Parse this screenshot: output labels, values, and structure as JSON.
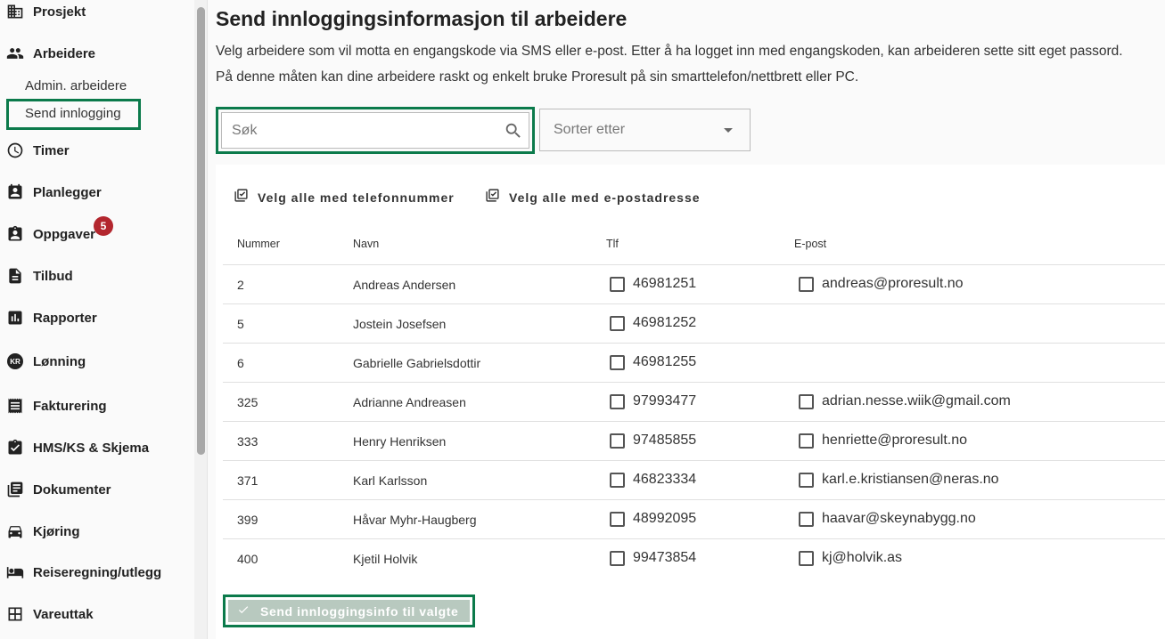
{
  "sidebar": {
    "items": [
      {
        "label": "Prosjekt",
        "icon": "building-icon"
      },
      {
        "label": "Arbeidere",
        "icon": "people-icon"
      },
      {
        "label": "Timer",
        "icon": "clock-icon"
      },
      {
        "label": "Planlegger",
        "icon": "planner-icon"
      },
      {
        "label": "Oppgaver",
        "icon": "tasks-icon",
        "badge": "5"
      },
      {
        "label": "Tilbud",
        "icon": "document-icon"
      },
      {
        "label": "Rapporter",
        "icon": "bar-chart-icon"
      },
      {
        "label": "Lønning",
        "icon": "kr-icon",
        "icon_text": "KR"
      },
      {
        "label": "Fakturering",
        "icon": "receipt-icon"
      },
      {
        "label": "HMS/KS & Skjema",
        "icon": "clipboard-check-icon"
      },
      {
        "label": "Dokumenter",
        "icon": "library-icon"
      },
      {
        "label": "Kjøring",
        "icon": "car-icon"
      },
      {
        "label": "Reiseregning/utlegg",
        "icon": "bed-icon"
      },
      {
        "label": "Vareuttak",
        "icon": "dashboard-icon"
      }
    ],
    "subitems": [
      {
        "label": "Admin. arbeidere"
      },
      {
        "label": "Send innlogging",
        "active": true
      }
    ]
  },
  "page": {
    "title": "Send innloggingsinformasjon til arbeidere",
    "desc_line1": "Velg arbeidere som vil motta en engangskode via SMS eller e-post. Etter å ha logget inn med engangskoden, kan arbeideren sette sitt eget passord.",
    "desc_line2": "På denne måten kan dine arbeidere raskt og enkelt bruke Proresult på sin smarttelefon/nettbrett eller PC."
  },
  "search": {
    "placeholder": "Søk",
    "value": ""
  },
  "sort": {
    "placeholder": "Sorter etter"
  },
  "actions": {
    "select_all_phone": "Velg alle med telefonnummer",
    "select_all_email": "Velg alle med e-postadresse",
    "send_button": "Send innloggingsinfo til valgte"
  },
  "table": {
    "headers": [
      "Nummer",
      "Navn",
      "Tlf",
      "E-post"
    ],
    "rows": [
      {
        "nummer": "2",
        "navn": "Andreas Andersen",
        "tlf": "46981251",
        "epost": "andreas@proresult.no"
      },
      {
        "nummer": "5",
        "navn": "Jostein Josefsen",
        "tlf": "46981252",
        "epost": ""
      },
      {
        "nummer": "6",
        "navn": "Gabrielle Gabrielsdottir",
        "tlf": "46981255",
        "epost": ""
      },
      {
        "nummer": "325",
        "navn": "Adrianne Andreasen",
        "tlf": "97993477",
        "epost": "adrian.nesse.wiik@gmail.com"
      },
      {
        "nummer": "333",
        "navn": "Henry Henriksen",
        "tlf": "97485855",
        "epost": "henriette@proresult.no"
      },
      {
        "nummer": "371",
        "navn": "Karl Karlsson",
        "tlf": "46823334",
        "epost": "karl.e.kristiansen@neras.no"
      },
      {
        "nummer": "399",
        "navn": "Håvar Myhr-Haugberg",
        "tlf": "48992095",
        "epost": "haavar@skeynabygg.no"
      },
      {
        "nummer": "400",
        "navn": "Kjetil Holvik",
        "tlf": "99473854",
        "epost": "kj@holvik.as"
      }
    ]
  },
  "colors": {
    "highlight": "#0b7a4b",
    "badge": "#b3262e",
    "send_button_disabled": "#b8c9bf"
  }
}
